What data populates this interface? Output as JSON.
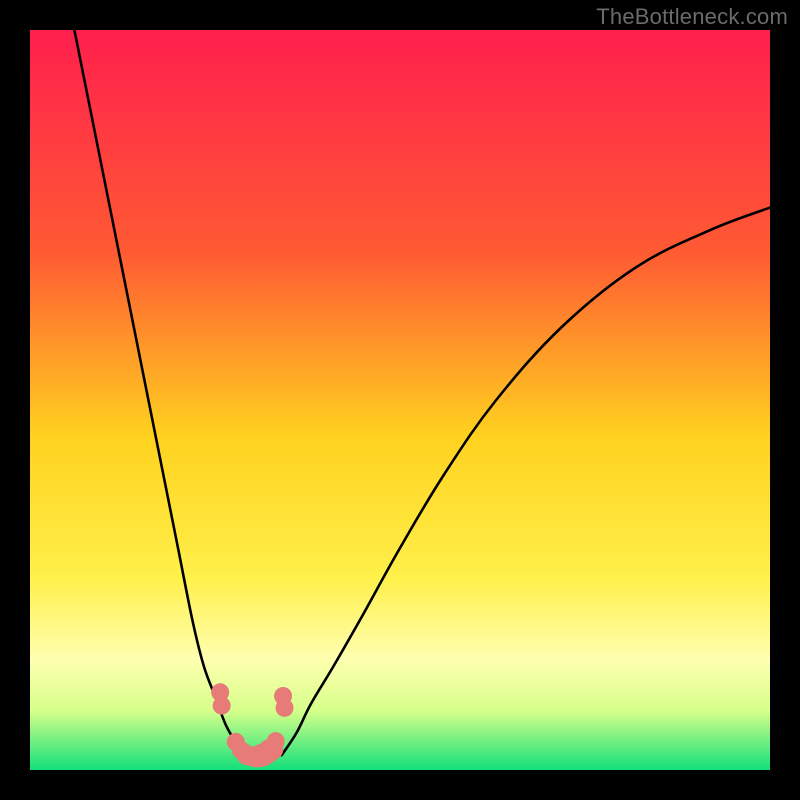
{
  "watermark": "TheBottleneck.com",
  "chart_data": {
    "type": "line",
    "title": "",
    "xlabel": "",
    "ylabel": "",
    "xlim": [
      0,
      100
    ],
    "ylim": [
      0,
      100
    ],
    "background_gradient": {
      "stops": [
        {
          "offset": 0,
          "color": "#ff1f4d"
        },
        {
          "offset": 30,
          "color": "#ff5a33"
        },
        {
          "offset": 55,
          "color": "#ffd21f"
        },
        {
          "offset": 74,
          "color": "#fff04a"
        },
        {
          "offset": 85,
          "color": "#ffffb0"
        },
        {
          "offset": 92,
          "color": "#d6ff8a"
        },
        {
          "offset": 100,
          "color": "#12e07a"
        }
      ]
    },
    "series": [
      {
        "name": "curve-left",
        "type": "line",
        "color": "#000000",
        "x": [
          6,
          8,
          10,
          12,
          14,
          16,
          18,
          20,
          22,
          23.5,
          25,
          26.5,
          28,
          29
        ],
        "y": [
          100,
          90,
          80,
          70,
          60,
          50,
          40,
          30,
          20,
          14,
          10,
          6,
          3.5,
          2
        ]
      },
      {
        "name": "curve-right",
        "type": "line",
        "color": "#000000",
        "x": [
          34,
          36,
          38,
          41,
          45,
          50,
          56,
          63,
          72,
          82,
          92,
          100
        ],
        "y": [
          2,
          5,
          9,
          14,
          21,
          30,
          40,
          50,
          60,
          68,
          73,
          76
        ]
      },
      {
        "name": "markers-left",
        "type": "scatter",
        "color": "#e77b78",
        "x": [
          25.7,
          25.9,
          27.8,
          28.5
        ],
        "y": [
          10.5,
          8.7,
          3.8,
          2.7
        ]
      },
      {
        "name": "markers-right",
        "type": "scatter",
        "color": "#e77b78",
        "x": [
          34.2,
          34.4,
          33.2,
          32.2,
          31.2,
          30.2,
          29.2
        ],
        "y": [
          10.0,
          8.4,
          3.9,
          2.9,
          2.3,
          2.0,
          1.9
        ]
      },
      {
        "name": "valley-fill",
        "type": "area",
        "color": "#e77b78",
        "x": [
          28.5,
          30.0,
          31.5,
          33.0
        ],
        "y": [
          2.7,
          1.7,
          1.7,
          2.7
        ]
      }
    ]
  }
}
